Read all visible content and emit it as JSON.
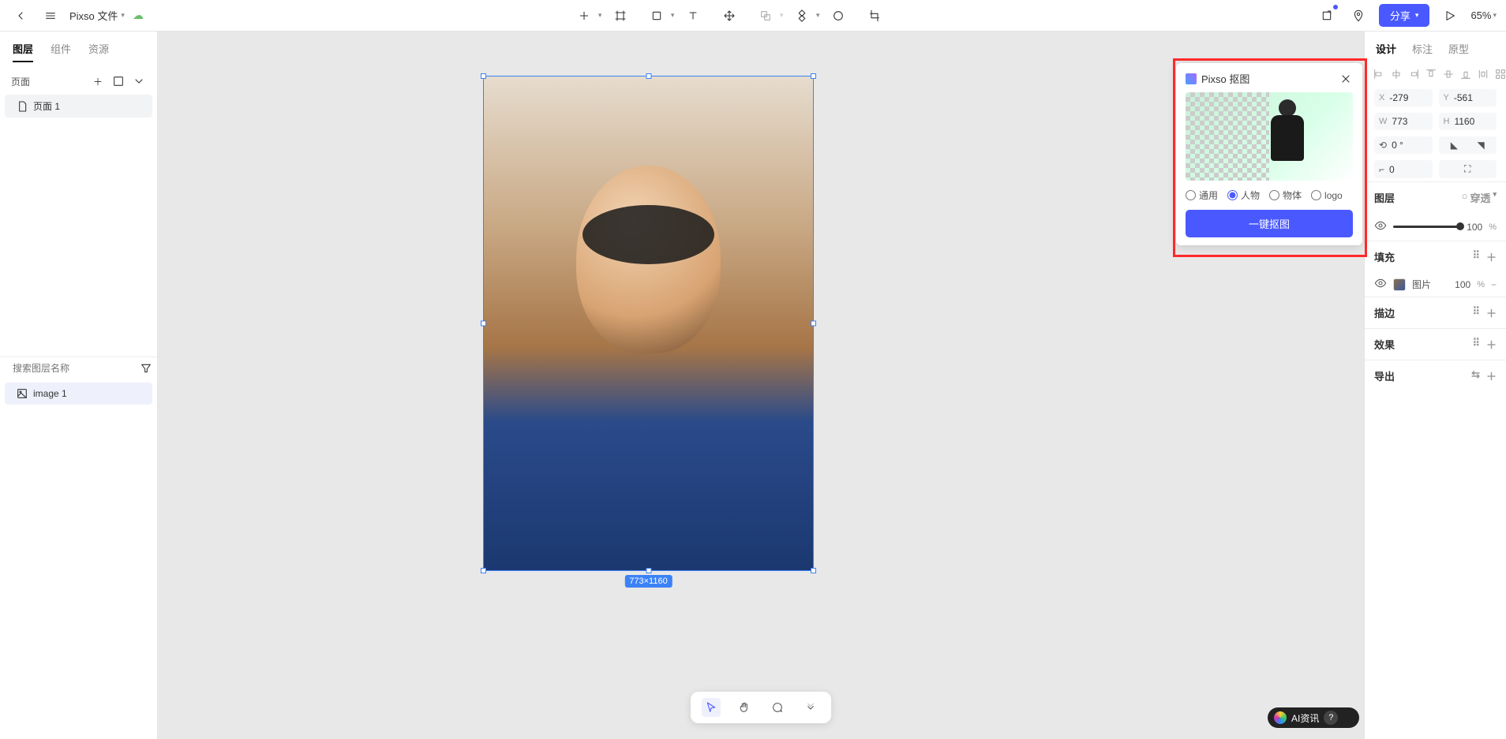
{
  "topbar": {
    "file_name": "Pixso 文件",
    "share": "分享",
    "zoom": "65%"
  },
  "left": {
    "tabs": {
      "layers": "图层",
      "components": "组件",
      "assets": "资源"
    },
    "pages_label": "页面",
    "pages": [
      "页面 1"
    ],
    "search_placeholder": "搜索图层名称",
    "layers": [
      "image 1"
    ]
  },
  "canvas": {
    "dimensions": "773×1160"
  },
  "cutout_panel": {
    "title": "Pixso 抠图",
    "options": {
      "general": "通用",
      "person": "人物",
      "object": "物体",
      "logo": "logo"
    },
    "selected": "person",
    "action": "一键抠图"
  },
  "bottom_toolbar": {},
  "right": {
    "tabs": {
      "design": "设计",
      "annotate": "标注",
      "prototype": "原型"
    },
    "x_label": "X",
    "x": "-279",
    "y_label": "Y",
    "y": "-561",
    "w_label": "W",
    "w": "773",
    "h_label": "H",
    "h": "1160",
    "rotation": "0 °",
    "corner": "0",
    "layer_section": "图层",
    "pass_through": "穿透",
    "opacity": "100",
    "opacity_unit": "%",
    "fill_section": "填充",
    "fill_type": "图片",
    "fill_opacity": "100",
    "fill_opacity_unit": "%",
    "stroke_section": "描边",
    "effect_section": "效果",
    "export_section": "导出"
  },
  "watermark": "AI资讯"
}
